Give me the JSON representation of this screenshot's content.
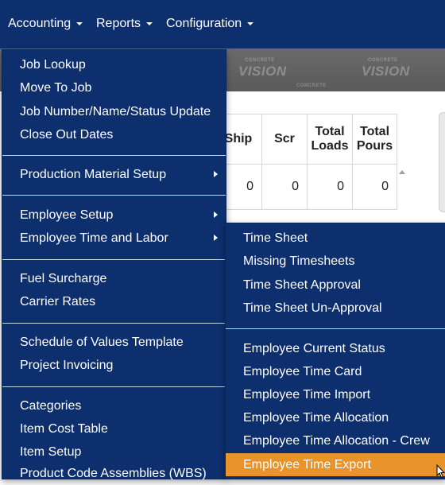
{
  "navbar": {
    "items": [
      {
        "label": "Accounting"
      },
      {
        "label": "Reports"
      },
      {
        "label": "Configuration"
      }
    ]
  },
  "logo_strip": {
    "brand_top": "CONCRETE",
    "brand_name": "VISION"
  },
  "table": {
    "headers": [
      "Ship",
      "Scr",
      "Total Loads",
      "Total Pours"
    ],
    "headers_lines": [
      [
        "Ship"
      ],
      [
        "Scr"
      ],
      [
        "Total",
        "Loads"
      ],
      [
        "Total",
        "Pours"
      ]
    ],
    "row": [
      "0",
      "0",
      "0",
      "0"
    ]
  },
  "main_menu": {
    "items": [
      "Job Lookup",
      "Move To Job",
      "Job Number/Name/Status Update",
      "Close Out Dates",
      "Production Material Setup",
      "Employee Setup",
      "Employee Time and Labor",
      "Fuel Surcharge",
      "Carrier Rates",
      "Schedule of Values Template",
      "Project Invoicing",
      "Categories",
      "Item Cost Table",
      "Item Setup",
      "Product Code Assemblies (WBS)"
    ]
  },
  "sub_menu": {
    "items": [
      "Time Sheet",
      "Missing Timesheets",
      "Time Sheet Approval",
      "Time Sheet Un-Approval",
      "Employee Current Status",
      "Employee Time Card",
      "Employee Time Import",
      "Employee Time Allocation",
      "Employee Time Allocation - Crew",
      "Employee Time Export"
    ],
    "active_item": "Employee Time Export"
  },
  "colors": {
    "navbar_bg": "#0e2f6e",
    "menu_bg": "#0e2f6e",
    "active_item_bg": "#e8932c"
  }
}
